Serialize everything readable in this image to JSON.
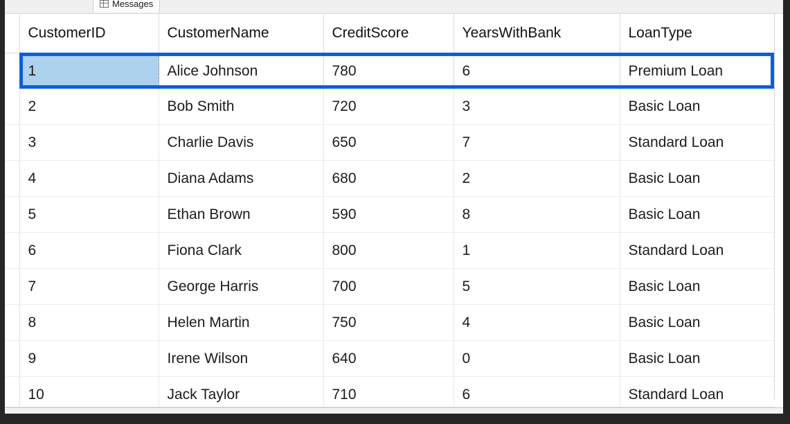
{
  "window": {
    "frame_color": "#262626",
    "client_background": "#ffffff"
  },
  "tabs": {
    "items": [
      {
        "label": "Messages",
        "icon": "grid-icon",
        "active": false
      }
    ]
  },
  "results_grid": {
    "columns": [
      "CustomerID",
      "CustomerName",
      "CreditScore",
      "YearsWithBank",
      "LoanType"
    ],
    "rows": [
      {
        "CustomerID": "1",
        "CustomerName": "Alice Johnson",
        "CreditScore": "780",
        "YearsWithBank": "6",
        "LoanType": "Premium Loan"
      },
      {
        "CustomerID": "2",
        "CustomerName": "Bob Smith",
        "CreditScore": "720",
        "YearsWithBank": "3",
        "LoanType": "Basic Loan"
      },
      {
        "CustomerID": "3",
        "CustomerName": "Charlie Davis",
        "CreditScore": "650",
        "YearsWithBank": "7",
        "LoanType": "Standard Loan"
      },
      {
        "CustomerID": "4",
        "CustomerName": "Diana Adams",
        "CreditScore": "680",
        "YearsWithBank": "2",
        "LoanType": "Basic Loan"
      },
      {
        "CustomerID": "5",
        "CustomerName": "Ethan Brown",
        "CreditScore": "590",
        "YearsWithBank": "8",
        "LoanType": "Basic Loan"
      },
      {
        "CustomerID": "6",
        "CustomerName": "Fiona Clark",
        "CreditScore": "800",
        "YearsWithBank": "1",
        "LoanType": "Standard Loan"
      },
      {
        "CustomerID": "7",
        "CustomerName": "George Harris",
        "CreditScore": "700",
        "YearsWithBank": "5",
        "LoanType": "Basic Loan"
      },
      {
        "CustomerID": "8",
        "CustomerName": "Helen Martin",
        "CreditScore": "750",
        "YearsWithBank": "4",
        "LoanType": "Basic Loan"
      },
      {
        "CustomerID": "9",
        "CustomerName": "Irene Wilson",
        "CreditScore": "640",
        "YearsWithBank": "0",
        "LoanType": "Basic Loan"
      },
      {
        "CustomerID": "10",
        "CustomerName": "Jack Taylor",
        "CreditScore": "710",
        "YearsWithBank": "6",
        "LoanType": "Standard Loan"
      }
    ],
    "selected_row_index": 0,
    "current_cell_column": "CustomerID",
    "selection_border_color": "#0A5FE0",
    "selected_cell_fill": "#ADD2EE",
    "row_count": 10
  }
}
